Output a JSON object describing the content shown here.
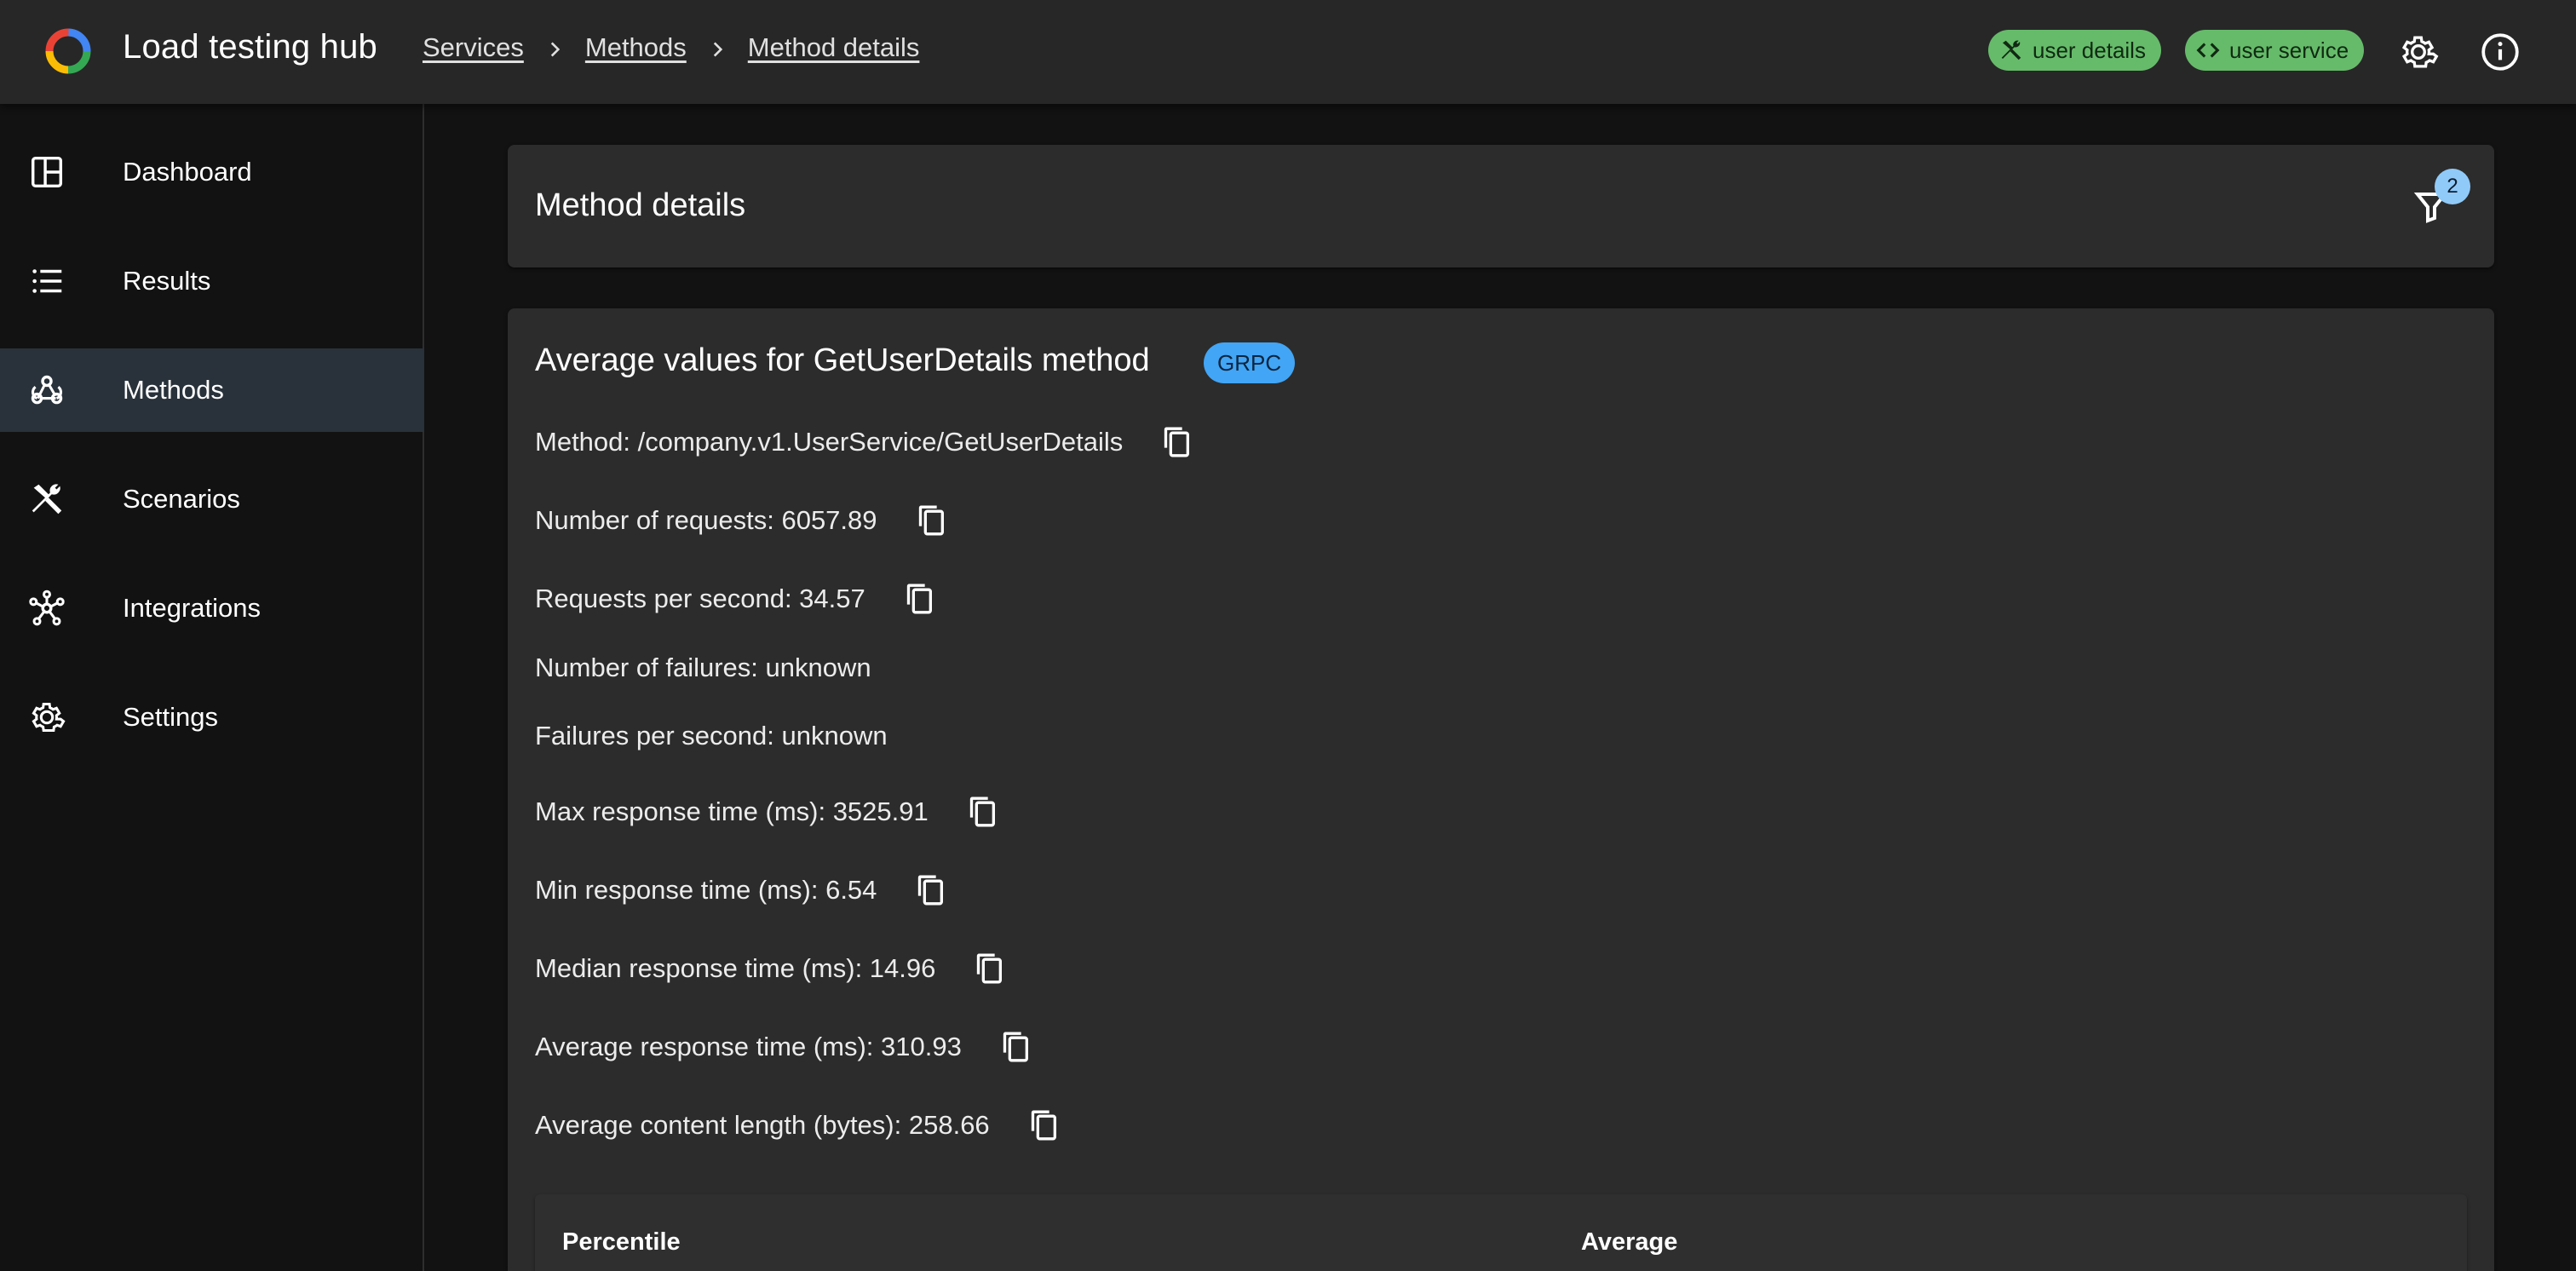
{
  "header": {
    "app_title": "Load testing hub",
    "breadcrumbs": [
      "Services",
      "Methods",
      "Method details"
    ],
    "chips": [
      {
        "label": "user details",
        "icon": "tools-icon"
      },
      {
        "label": "user service",
        "icon": "code-icon"
      }
    ],
    "icons": [
      "gear-icon",
      "info-icon"
    ],
    "chip_color": "#66bb6a"
  },
  "sidebar": {
    "items": [
      {
        "label": "Dashboard",
        "icon": "dashboard-icon",
        "active": false
      },
      {
        "label": "Results",
        "icon": "list-icon",
        "active": false
      },
      {
        "label": "Methods",
        "icon": "webhook-icon",
        "active": true
      },
      {
        "label": "Scenarios",
        "icon": "tools-icon",
        "active": false
      },
      {
        "label": "Integrations",
        "icon": "hub-icon",
        "active": false
      },
      {
        "label": "Settings",
        "icon": "gear-icon",
        "active": false
      }
    ]
  },
  "main": {
    "title_card": {
      "title": "Method details",
      "filter_count": "2"
    },
    "details": {
      "title": "Average values for GetUserDetails method",
      "protocol_badge": "GRPC",
      "stats": [
        {
          "label": "Method: /company.v1.UserService/GetUserDetails",
          "copyable": true
        },
        {
          "label": "Number of requests: 6057.89",
          "copyable": true
        },
        {
          "label": "Requests per second: 34.57",
          "copyable": true
        },
        {
          "label": "Number of failures: unknown",
          "copyable": false
        },
        {
          "label": "Failures per second: unknown",
          "copyable": false
        },
        {
          "label": "Max response time (ms): 3525.91",
          "copyable": true
        },
        {
          "label": "Min response time (ms): 6.54",
          "copyable": true
        },
        {
          "label": "Median response time (ms): 14.96",
          "copyable": true
        },
        {
          "label": "Average response time (ms): 310.93",
          "copyable": true
        },
        {
          "label": "Average content length (bytes): 258.66",
          "copyable": true
        }
      ],
      "table": {
        "columns": [
          "Percentile",
          "Average"
        ]
      }
    }
  },
  "colors": {
    "background": "#121212",
    "surface": "#2c2c2c",
    "active_nav": "#29323b",
    "badge_blue": "#42a5f5",
    "filter_badge": "#90caf9"
  }
}
